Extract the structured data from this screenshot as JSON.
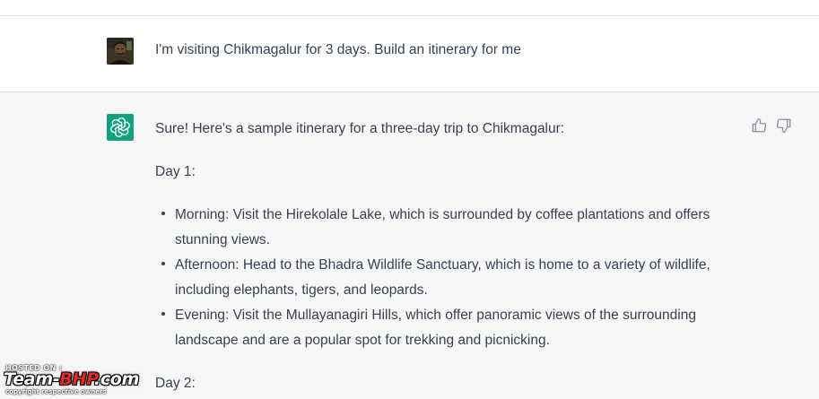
{
  "conversation": {
    "user_message": {
      "avatar_icon": "user-photo",
      "text": "I'm visiting Chikmagalur for 3 days. Build an itinerary for me"
    },
    "assistant_message": {
      "avatar_icon": "openai-logo-icon",
      "intro": "Sure! Here's a sample itinerary for a three-day trip to Chikmagalur:",
      "day1_heading": "Day 1:",
      "day1_items": [
        "Morning: Visit the Hirekolale Lake, which is surrounded by coffee plantations and offers stunning views.",
        "Afternoon: Head to the Bhadra Wildlife Sanctuary, which is home to a variety of wildlife, including elephants, tigers, and leopards.",
        "Evening: Visit the Mullayanagiri Hills, which offer panoramic views of the surrounding landscape and are a popular spot for trekking and picnicking."
      ],
      "day2_heading": "Day 2:",
      "feedback": {
        "thumbs_up_icon": "thumbs-up-icon",
        "thumbs_down_icon": "thumbs-down-icon"
      }
    }
  },
  "watermark": {
    "hosted_on": "HOSTED ON :",
    "logo_prefix": "Team-",
    "logo_brand": "BHP",
    "logo_suffix": ".com",
    "copyright": "copyright respective owners"
  },
  "colors": {
    "assistant_avatar_bg": "#10a37f",
    "assistant_row_bg": "#f7f7f8",
    "user_row_bg": "#ffffff",
    "text": "#374151",
    "watermark_brand": "#e32b21"
  }
}
